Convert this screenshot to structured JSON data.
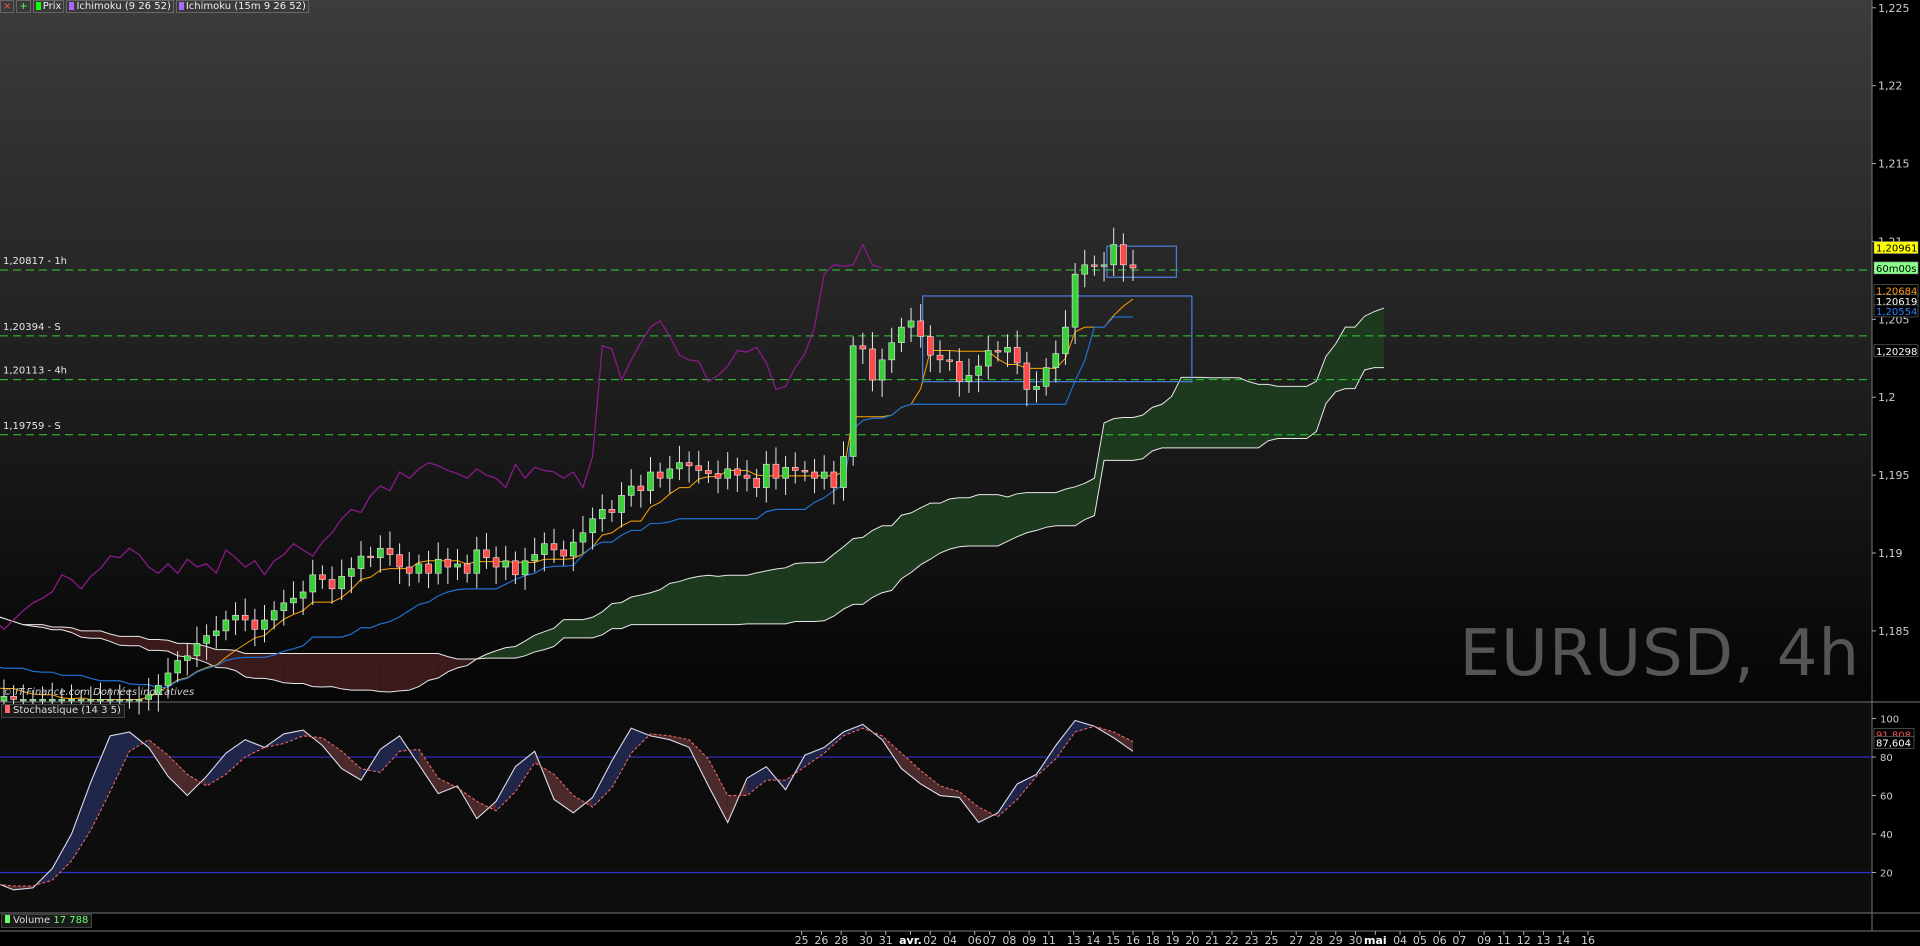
{
  "toolbar": {
    "price_label": "Prix",
    "ichimoku1": "Ichimoku (9 26 52)",
    "ichimoku2": "Ichimoku (15m 9 26 52)"
  },
  "watermark": "EURUSD, 4h",
  "copyright": "© IT-Finance.com Données indicatives",
  "stoch_label": "Stochastique (14 3 5)",
  "volume_label": "Volume",
  "volume_value": "17 788",
  "chart_data": [
    {
      "type": "candlestick",
      "title": "",
      "ylim": [
        1.1805,
        1.2255
      ],
      "price_ticks": [
        "1,225",
        "1,22",
        "1,215",
        "1,21",
        "1,205",
        "1,2",
        "1,195",
        "1,19",
        "1,185"
      ],
      "price_tick_values": [
        1.225,
        1.22,
        1.215,
        1.21,
        1.205,
        1.2,
        1.195,
        1.19,
        1.185
      ],
      "horizontal_levels": [
        {
          "label": "1,20817 - 1h",
          "value": 1.20817
        },
        {
          "label": "1,20394 - S",
          "value": 1.20394
        },
        {
          "label": "1,20113 - 4h",
          "value": 1.20113
        },
        {
          "label": "1,19759 - S",
          "value": 1.19759
        }
      ],
      "value_flags": [
        {
          "text": "1,20961",
          "value": 1.20961,
          "color": "#ffff00",
          "fg": "#000000"
        },
        {
          "text": "60m00s",
          "value": 1.2083,
          "color": "#8aff8a",
          "fg": "#000000"
        },
        {
          "text": "1,20684",
          "value": 1.20684,
          "color": "#000000",
          "fg": "#ff9a1a"
        },
        {
          "text": "1,20619",
          "value": 1.20619,
          "color": "#000000",
          "fg": "#ffffff"
        },
        {
          "text": "1,20554",
          "value": 1.20554,
          "color": "#000000",
          "fg": "#2a7fff"
        },
        {
          "text": "1,20298",
          "value": 1.20298,
          "color": "#000000",
          "fg": "#ffffff"
        }
      ],
      "x_ticks": [
        "25",
        "26",
        "28",
        "30",
        "31",
        "avr.",
        "02",
        "04",
        "06",
        "07",
        "08",
        "09",
        "11",
        "13",
        "14",
        "15",
        "16",
        "18",
        "19",
        "20",
        "21",
        "22",
        "23",
        "25",
        "27",
        "28",
        "29",
        "30",
        "mai",
        "04",
        "05",
        "06",
        "07",
        "09",
        "11",
        "12",
        "13",
        "14",
        "16"
      ],
      "x_tick_index": [
        -67,
        -63,
        -59,
        -54,
        -50,
        -45,
        -41,
        -37,
        -32,
        -29,
        -25,
        -21,
        -17,
        -12,
        -8,
        -4,
        0,
        4,
        8,
        12,
        16,
        20,
        24,
        28,
        33,
        37,
        41,
        45,
        49,
        54,
        58,
        62,
        66,
        71,
        75,
        79,
        83,
        87,
        92
      ],
      "closes": [
        1.1866,
        1.1862,
        1.1858,
        1.1855,
        1.1859,
        1.1854,
        1.185,
        1.1846,
        1.1842,
        1.1847,
        1.1843,
        1.1839,
        1.1842,
        1.1838,
        1.1834,
        1.1838,
        1.1834,
        1.183,
        1.1827,
        1.1831,
        1.1827,
        1.1823,
        1.1826,
        1.1822,
        1.1818,
        1.1821,
        1.1817,
        1.1814,
        1.181,
        1.1813,
        1.1809,
        1.1805,
        1.1808,
        1.1806,
        1.1806,
        1.1806,
        1.1806,
        1.1806,
        1.1806,
        1.1806,
        1.1806,
        1.1806,
        1.1806,
        1.1806,
        1.1806,
        1.1806,
        1.1806,
        1.1809,
        1.1815,
        1.1823,
        1.1831,
        1.1834,
        1.1842,
        1.1847,
        1.185,
        1.1857,
        1.186,
        1.1857,
        1.1851,
        1.1857,
        1.1863,
        1.1868,
        1.1871,
        1.1875,
        1.1886,
        1.1883,
        1.1877,
        1.1885,
        1.189,
        1.1898,
        1.1897,
        1.1903,
        1.1899,
        1.1891,
        1.1887,
        1.1893,
        1.1887,
        1.1896,
        1.1891,
        1.1893,
        1.1887,
        1.1902,
        1.1897,
        1.1891,
        1.1895,
        1.1886,
        1.1895,
        1.1899,
        1.1906,
        1.1902,
        1.1898,
        1.1907,
        1.1913,
        1.1922,
        1.1928,
        1.1926,
        1.1937,
        1.1943,
        1.194,
        1.1952,
        1.1948,
        1.1954,
        1.1958,
        1.1956,
        1.1953,
        1.1951,
        1.1948,
        1.1954,
        1.195,
        1.1948,
        1.1942,
        1.1957,
        1.1948,
        1.1955,
        1.1953,
        1.1952,
        1.1948,
        1.1952,
        1.1942,
        1.1962,
        1.2033,
        1.2031,
        1.2011,
        1.2024,
        1.2035,
        1.2045,
        1.2049,
        1.2039,
        1.2027,
        1.2024,
        1.2023,
        1.201,
        1.2014,
        1.202,
        1.203,
        1.2029,
        1.2032,
        1.2022,
        1.2005,
        1.2007,
        1.2019,
        1.2028,
        1.2045,
        1.2079,
        1.2085,
        1.2084,
        1.2085,
        1.2098,
        1.2085,
        1.2083
      ],
      "ichimoku": {
        "tenkan_color": "#ffa500",
        "kijun_color": "#2070d0",
        "chikou_color": "#8a1a8a",
        "cloud_bull_color": "#1e3a1e",
        "cloud_bear_color": "#3a1a1a"
      },
      "rectangles": [
        {
          "from_index": 18,
          "to_index": 36,
          "top": 1.2065,
          "bottom": 1.201
        },
        {
          "from_index": 32,
          "to_index": 40,
          "top": 1.2097,
          "bottom": 1.2077
        }
      ]
    },
    {
      "type": "line",
      "title": "Stochastique (14 3 5)",
      "ylim": [
        0,
        106
      ],
      "y_ticks": [
        100,
        80,
        60,
        40,
        20
      ],
      "levels": [
        80,
        20
      ],
      "value_flags": [
        {
          "text": "91,808",
          "value": 91.808,
          "color": "#000000",
          "fg": "#ff5050"
        },
        {
          "text": "87,604",
          "value": 87.604,
          "color": "#000000",
          "fg": "#ffffff"
        }
      ],
      "k": [
        18,
        17,
        14,
        13,
        16,
        24,
        34,
        41,
        44,
        41,
        28,
        16,
        13,
        15,
        15,
        11,
        12,
        22,
        40,
        67,
        91,
        93,
        85,
        70,
        60,
        70,
        82,
        89,
        85,
        92,
        94,
        86,
        74,
        68,
        84,
        91,
        76,
        61,
        65,
        48,
        57,
        75,
        83,
        58,
        51,
        59,
        78,
        95,
        91,
        89,
        85,
        65,
        46,
        69,
        75,
        63,
        81,
        85,
        93,
        97,
        89,
        74,
        66,
        60,
        59,
        46,
        51,
        66,
        71,
        86,
        99,
        96,
        90,
        83
      ],
      "d": [
        13,
        14,
        13,
        12,
        13,
        16,
        24,
        33,
        40,
        42,
        38,
        28,
        19,
        14,
        14,
        13,
        13,
        16,
        26,
        42,
        62,
        83,
        89,
        81,
        71,
        65,
        71,
        80,
        85,
        87,
        91,
        90,
        83,
        74,
        72,
        83,
        84,
        69,
        64,
        57,
        52,
        62,
        77,
        71,
        60,
        54,
        64,
        82,
        92,
        91,
        89,
        79,
        60,
        60,
        68,
        68,
        75,
        82,
        91,
        95,
        91,
        82,
        73,
        65,
        62,
        54,
        49,
        58,
        70,
        79,
        93,
        96,
        93,
        88
      ]
    }
  ]
}
